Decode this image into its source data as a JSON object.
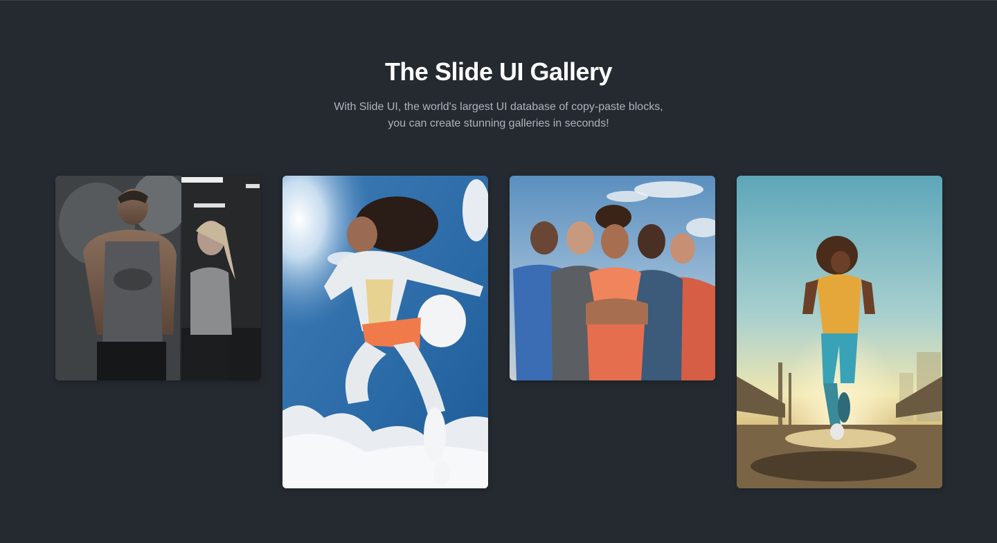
{
  "header": {
    "title": "The Slide UI Gallery",
    "subtitle_line1": "With Slide UI, the world's largest UI database of copy-paste blocks,",
    "subtitle_line2": "you can create stunning galleries in seconds!"
  },
  "gallery": {
    "images": [
      {
        "subject": "gym-couple-photo"
      },
      {
        "subject": "jumping-athlete-sky-photo"
      },
      {
        "subject": "team-of-athletes-photo"
      },
      {
        "subject": "runner-sunset-bridge-photo"
      }
    ]
  },
  "colors": {
    "background": "#242a30",
    "title": "#ffffff",
    "subtitle": "#aeb4bb"
  }
}
